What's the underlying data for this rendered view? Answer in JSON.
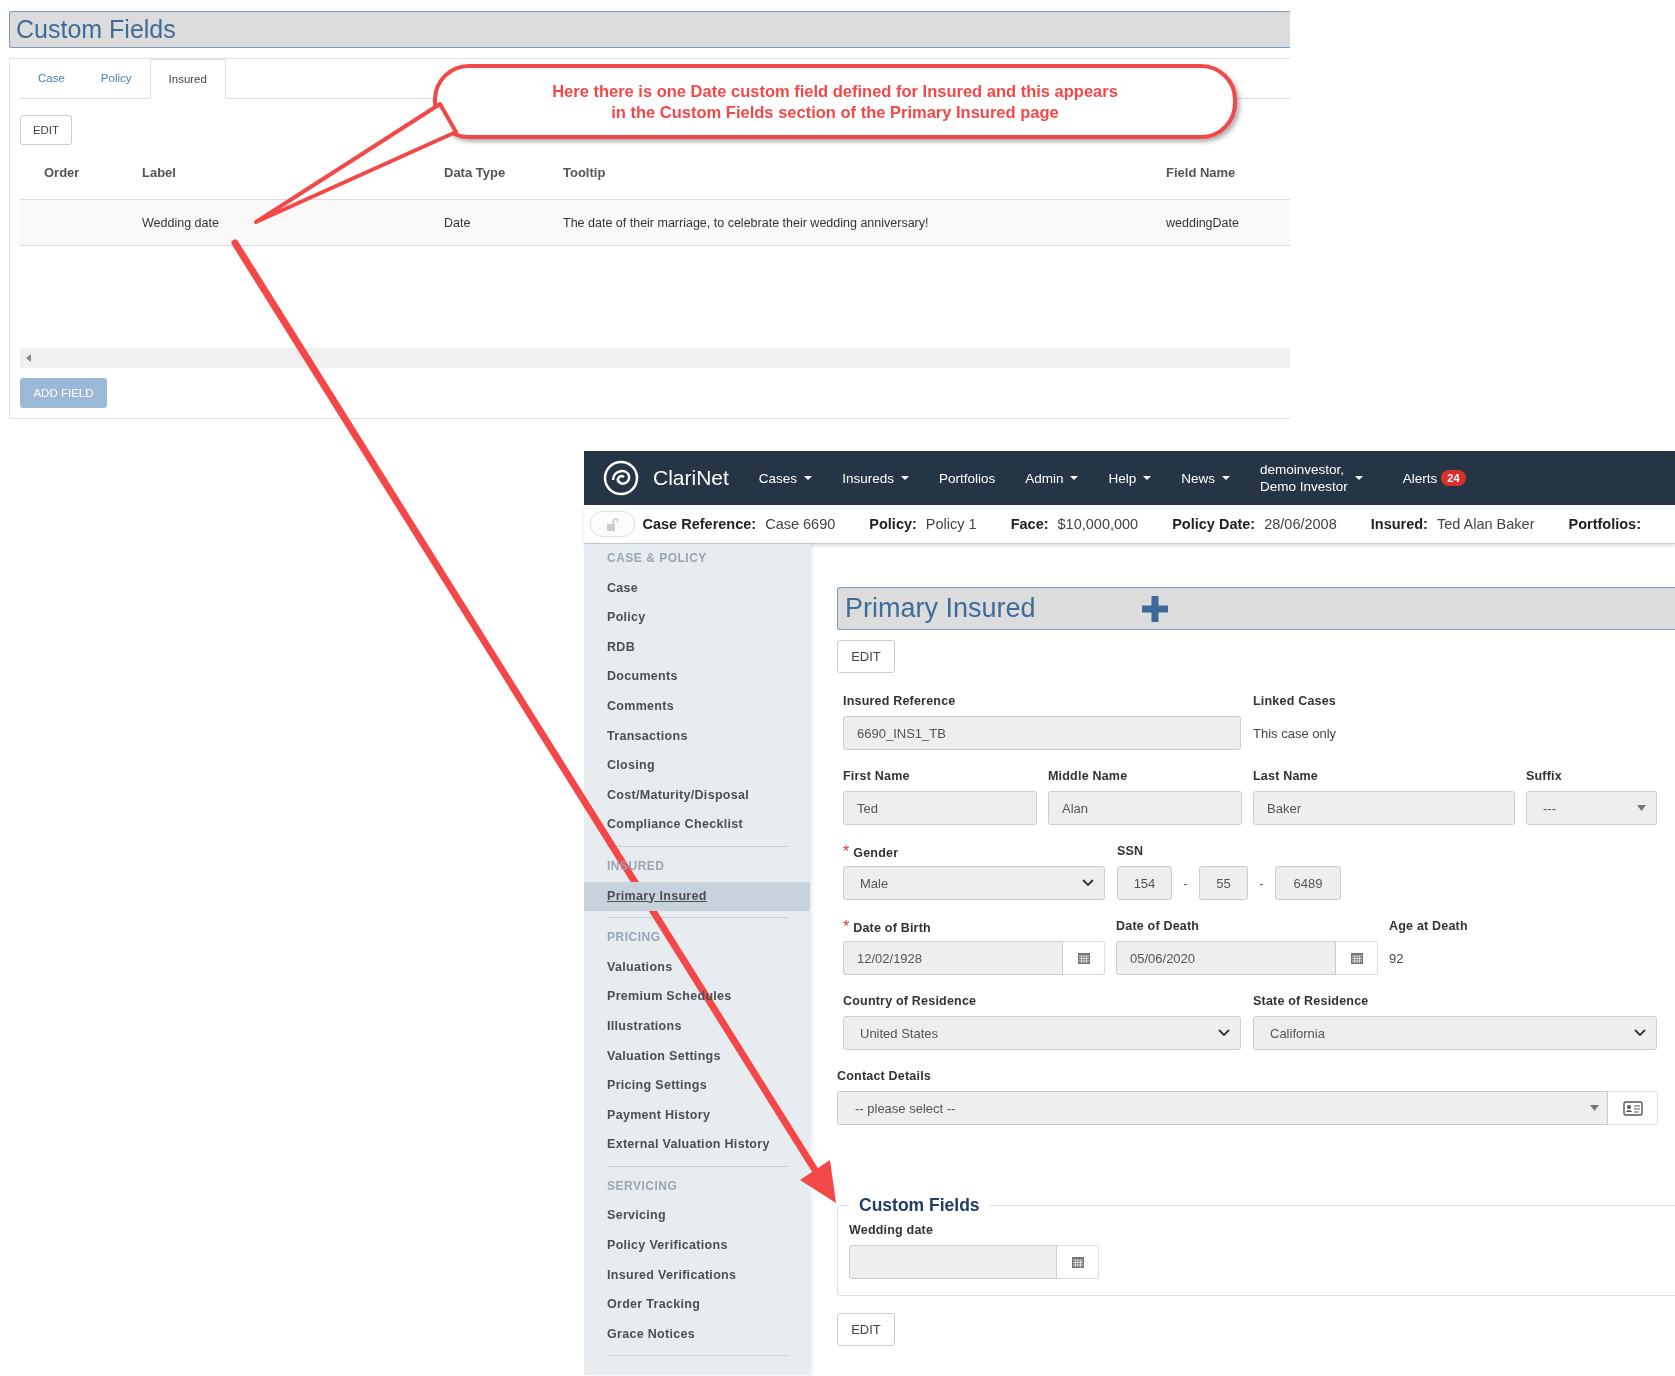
{
  "custom_fields_panel": {
    "title": "Custom Fields",
    "tabs": [
      {
        "label": "Case",
        "selected": false
      },
      {
        "label": "Policy",
        "selected": false
      },
      {
        "label": "Insured",
        "selected": true
      }
    ],
    "edit_button": "EDIT",
    "table": {
      "columns": [
        "Order",
        "Label",
        "Data Type",
        "Tooltip",
        "Field Name"
      ],
      "rows": [
        {
          "label": "Wedding date",
          "data_type": "Date",
          "tooltip": "The date of their marriage, to celebrate their wedding anniversary!",
          "field_name": "weddingDate"
        }
      ]
    },
    "add_button": "ADD FIELD"
  },
  "callout": {
    "lines": [
      "Here there is one Date custom field defined for Insured and this appears",
      "in the Custom Fields section of the Primary Insured page"
    ]
  },
  "app": {
    "brand": "ClariNet",
    "nav": [
      {
        "label": "Cases",
        "dropdown": true
      },
      {
        "label": "Insureds",
        "dropdown": true
      },
      {
        "label": "Portfolios",
        "dropdown": false
      },
      {
        "label": "Admin",
        "dropdown": true
      },
      {
        "label": "Help",
        "dropdown": true
      },
      {
        "label": "News",
        "dropdown": true
      }
    ],
    "user": {
      "lines": [
        "demoinvestor,",
        "Demo Investor"
      ]
    },
    "alerts": {
      "label": "Alerts",
      "count": "24"
    },
    "lock": {
      "locked": false
    },
    "info_bar": [
      {
        "label": "Case Reference:",
        "value": "Case 6690"
      },
      {
        "label": "Policy:",
        "value": "Policy 1"
      },
      {
        "label": "Face:",
        "value": "$10,000,000"
      },
      {
        "label": "Policy Date:",
        "value": "28/06/2008"
      },
      {
        "label": "Insured:",
        "value": "Ted Alan Baker"
      },
      {
        "label": "Portfolios:"
      }
    ],
    "sidebar": [
      {
        "header": "CASE & POLICY",
        "items": [
          {
            "label": "Case",
            "selected": false
          },
          {
            "label": "Policy",
            "selected": false
          },
          {
            "label": "RDB",
            "selected": false
          },
          {
            "label": "Documents",
            "selected": false
          },
          {
            "label": "Comments",
            "selected": false
          },
          {
            "label": "Transactions",
            "selected": false
          },
          {
            "label": "Closing",
            "selected": false
          },
          {
            "label": "Cost/Maturity/Disposal",
            "selected": false
          },
          {
            "label": "Compliance Checklist",
            "selected": false
          }
        ]
      },
      {
        "header": "INSURED",
        "items": [
          {
            "label": "Primary Insured",
            "selected": true
          }
        ]
      },
      {
        "header": "PRICING",
        "items": [
          {
            "label": "Valuations",
            "selected": false
          },
          {
            "label": "Premium Schedules",
            "selected": false
          },
          {
            "label": "Illustrations",
            "selected": false
          },
          {
            "label": "Valuation Settings",
            "selected": false
          },
          {
            "label": "Pricing Settings",
            "selected": false
          },
          {
            "label": "Payment History",
            "selected": false
          },
          {
            "label": "External Valuation History",
            "selected": false
          }
        ]
      },
      {
        "header": "SERVICING",
        "items": [
          {
            "label": "Servicing",
            "selected": false
          },
          {
            "label": "Policy Verifications",
            "selected": false
          },
          {
            "label": "Insured Verifications",
            "selected": false
          },
          {
            "label": "Order Tracking",
            "selected": false
          },
          {
            "label": "Grace Notices",
            "selected": false
          }
        ]
      }
    ],
    "main": {
      "title": "Primary Insured",
      "edit_button": "EDIT",
      "form_rows": [
        {
          "fields": [
            {
              "label": "Insured Reference",
              "kind": "text",
              "value": "6690_INS1_TB"
            },
            {
              "label": "Linked Cases",
              "kind": "static",
              "value": "This case only"
            }
          ]
        },
        {
          "fields": [
            {
              "label": "First Name",
              "kind": "text",
              "value": "Ted"
            },
            {
              "label": "Middle Name",
              "kind": "text",
              "value": "Alan"
            },
            {
              "label": "Last Name",
              "kind": "text",
              "value": "Baker"
            },
            {
              "label": "Suffix",
              "kind": "combo",
              "value": "---"
            }
          ]
        },
        {
          "fields": [
            {
              "label": "Gender",
              "kind": "select",
              "required_mark": "*",
              "value": "Male"
            },
            {
              "label": "SSN",
              "kind": "ssn",
              "parts": [
                "154",
                "55",
                "6489"
              ],
              "separators": [
                "-",
                "-"
              ]
            }
          ]
        },
        {
          "fields": [
            {
              "label": "Date of Birth",
              "kind": "date",
              "required_mark": "*",
              "value": "12/02/1928"
            },
            {
              "label": "Date of Death",
              "kind": "date",
              "value": "05/06/2020"
            },
            {
              "label": "Age at Death",
              "kind": "static",
              "value": "92"
            }
          ]
        },
        {
          "fields": [
            {
              "label": "Country of Residence",
              "kind": "select",
              "value": "United States"
            },
            {
              "label": "State of Residence",
              "kind": "select",
              "value": "California"
            }
          ]
        }
      ],
      "contact": {
        "label": "Contact Details",
        "placeholder": "-- please select --"
      },
      "custom_fields": {
        "legend": "Custom Fields",
        "fields": [
          {
            "label": "Wedding date",
            "kind": "date"
          }
        ]
      },
      "bottom_edit_button": "EDIT"
    }
  }
}
